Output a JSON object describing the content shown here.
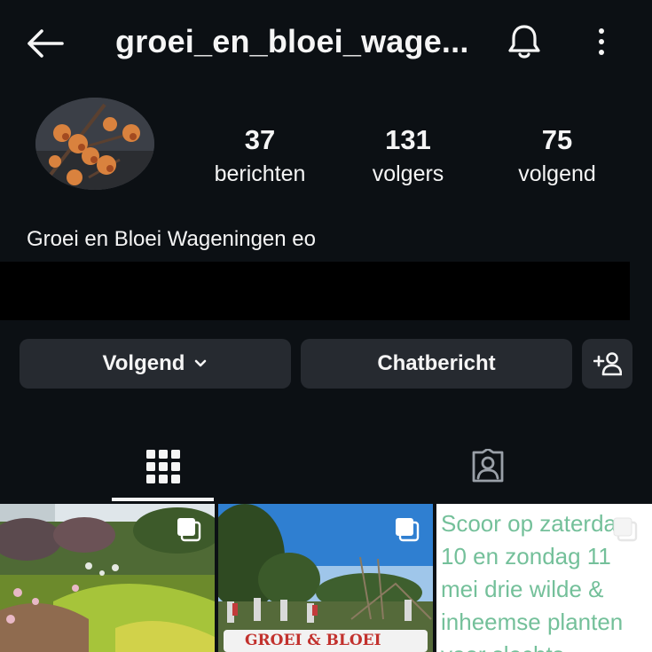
{
  "header": {
    "username": "groei_en_bloei_wage...",
    "icons": {
      "back": "arrow-left-icon",
      "notifications": "bell-icon",
      "more": "more-vertical-icon"
    }
  },
  "profile": {
    "stats": [
      {
        "value": "37",
        "label": "berichten"
      },
      {
        "value": "131",
        "label": "volgers"
      },
      {
        "value": "75",
        "label": "volgend"
      }
    ],
    "display_name": "Groei en Bloei Wageningen eo"
  },
  "actions": {
    "follow_label": "Volgend",
    "message_label": "Chatbericht"
  },
  "tabs": [
    {
      "icon": "grid-icon",
      "active": true
    },
    {
      "icon": "tagged-person-icon",
      "active": false
    }
  ],
  "posts": [
    {
      "type": "image",
      "multi": true
    },
    {
      "type": "image",
      "multi": true,
      "banner_text": "GROEI & BLOEI"
    },
    {
      "type": "text",
      "multi": true,
      "text": "Scoor op zaterdag 10 en zondag 11 mei drie wilde & inheemse planten voor slechts"
    }
  ],
  "colors": {
    "background": "#0c1014",
    "button": "#262a30",
    "text": "#f5f5f5",
    "post_text_green": "#74c09a"
  }
}
